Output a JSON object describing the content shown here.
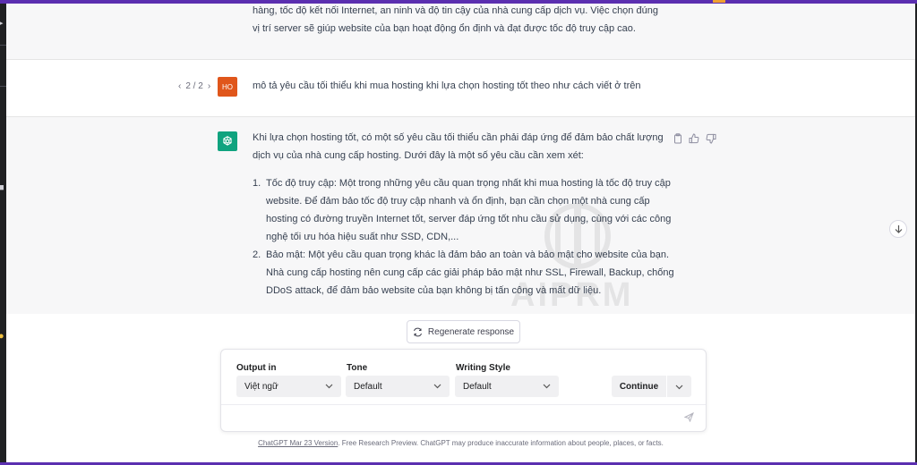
{
  "colors": {
    "accent_bar": "#5b2fb0",
    "user_avatar": "#e0561b",
    "ai_avatar": "#10a37f",
    "sidebar": "#202123"
  },
  "previous_response": {
    "lines": [
      "hàng, tốc độ kết nối Internet, an ninh và độ tin cậy của nhà cung cấp dịch vụ. Việc chọn đúng",
      "vị trí server sẽ giúp website của bạn hoạt động ổn định và đạt được tốc độ truy cập cao."
    ]
  },
  "user_message": {
    "pager": {
      "prev_icon": "chevron-left-icon",
      "label": "2 / 2",
      "next_icon": "chevron-right-icon"
    },
    "avatar_initials": "HO",
    "text": "mô tả yêu cầu tối thiểu khi mua hosting khi lựa chọn hosting tốt theo như cách viết ở trên"
  },
  "ai_response": {
    "avatar_icon": "openai-logo-icon",
    "intro": "Khi lựa chọn hosting tốt, có một số yêu cầu tối thiểu cần phải đáp ứng để đảm bảo chất lượng dịch vụ của nhà cung cấp hosting. Dưới đây là một số yêu cầu cần xem xét:",
    "items": [
      {
        "num": "1.",
        "text": "Tốc độ truy cập: Một trong những yêu cầu quan trọng nhất khi mua hosting là tốc độ truy cập website. Để đảm bảo tốc độ truy cập nhanh và ổn định, bạn cần chọn một nhà cung cấp hosting có đường truyền Internet tốt, server đáp ứng tốt nhu cầu sử dụng, cùng với các công nghệ tối ưu hóa hiệu suất như SSD, CDN,..."
      },
      {
        "num": "2.",
        "text": "Bảo mật: Một yêu cầu quan trọng khác là đảm bảo an toàn và bảo mật cho website của bạn. Nhà cung cấp hosting nên cung cấp các giải pháp bảo mật như SSL, Firewall, Backup, chống DDoS attack, để đảm bảo website của bạn không bị tấn công và mất dữ liệu."
      }
    ],
    "action_icons": [
      "copy-icon",
      "thumbs-up-icon",
      "thumbs-down-icon"
    ]
  },
  "watermark": {
    "text": "AIPRM"
  },
  "regenerate": {
    "icon": "refresh-icon",
    "label": "Regenerate response"
  },
  "prompt_bar": {
    "output_in": {
      "label": "Output in",
      "value": "Việt ngữ"
    },
    "tone": {
      "label": "Tone",
      "value": "Default"
    },
    "writing_style": {
      "label": "Writing Style",
      "value": "Default"
    },
    "continue_label": "Continue",
    "input_placeholder": "",
    "send_icon": "send-icon"
  },
  "footer": {
    "link_text": "ChatGPT Mar 23 Version",
    "text": ". Free Research Preview. ChatGPT may produce inaccurate information about people, places, or facts."
  }
}
